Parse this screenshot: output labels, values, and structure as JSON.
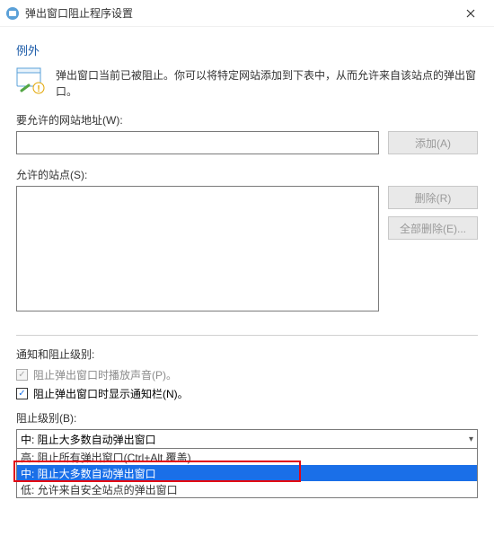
{
  "window": {
    "title": "弹出窗口阻止程序设置"
  },
  "exceptions": {
    "header": "例外",
    "info_text": "弹出窗口当前已被阻止。你可以将特定网站添加到下表中，从而允许来自该站点的弹出窗口。",
    "address_label": "要允许的网站地址(W):",
    "address_value": "",
    "add_button": "添加(A)",
    "allowed_label": "允许的站点(S):",
    "remove_button": "删除(R)",
    "remove_all_button": "全部删除(E)..."
  },
  "notifications": {
    "header": "通知和阻止级别:",
    "play_sound_label": "阻止弹出窗口时播放声音(P)。",
    "show_info_bar_label": "阻止弹出窗口时显示通知栏(N)。"
  },
  "blocking": {
    "level_label": "阻止级别(B):",
    "selected": "中: 阻止大多数自动弹出窗口",
    "options": {
      "high": "高: 阻止所有弹出窗口(Ctrl+Alt 覆盖)",
      "medium": "中: 阻止大多数自动弹出窗口",
      "low": "低: 允许来自安全站点的弹出窗口"
    }
  }
}
